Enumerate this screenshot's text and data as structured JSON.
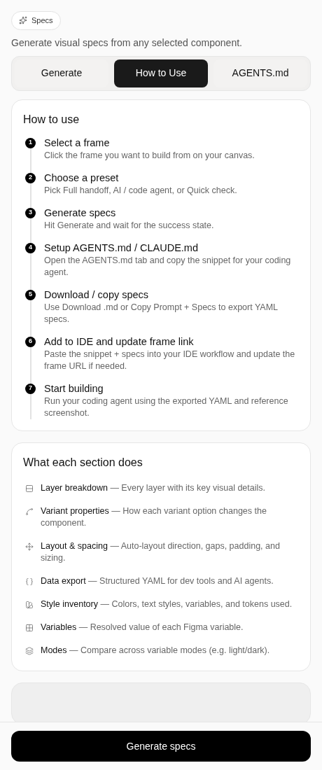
{
  "badge": {
    "label": "Specs"
  },
  "subtitle": "Generate visual specs from any selected component.",
  "tabs": [
    {
      "label": "Generate",
      "selected": false
    },
    {
      "label": "How to Use",
      "selected": true
    },
    {
      "label": "AGENTS.md",
      "selected": false
    }
  ],
  "how_to_use": {
    "title": "How to use",
    "steps": [
      {
        "number": "1",
        "title": "Select a frame",
        "description": "Click the frame you want to build from on your canvas."
      },
      {
        "number": "2",
        "title": "Choose a preset",
        "description": "Pick Full handoff, AI / code agent, or Quick check."
      },
      {
        "number": "3",
        "title": "Generate specs",
        "description": "Hit Generate and wait for the success state."
      },
      {
        "number": "4",
        "title": "Setup AGENTS.md / CLAUDE.md",
        "description": "Open the AGENTS.md tab and copy the snippet for your coding agent."
      },
      {
        "number": "5",
        "title": "Download / copy specs",
        "description": "Use Download .md or Copy Prompt + Specs to export YAML specs."
      },
      {
        "number": "6",
        "title": "Add to IDE and update frame link",
        "description": "Paste the snippet + specs into your IDE workflow and update the frame URL if needed."
      },
      {
        "number": "7",
        "title": "Start building",
        "description": "Run your coding agent using the exported YAML and reference screenshot."
      }
    ]
  },
  "sections": {
    "title": "What each section does",
    "items": [
      {
        "kind": "layers",
        "name": "Layer breakdown",
        "description": "— Every layer with its key visual details."
      },
      {
        "kind": "variants",
        "name": "Variant properties",
        "description": "— How each variant option changes the component."
      },
      {
        "kind": "layout",
        "name": "Layout & spacing",
        "description": "— Auto-layout direction, gaps, padding, and sizing."
      },
      {
        "kind": "data",
        "name": "Data export",
        "description": "— Structured YAML for dev tools and AI agents."
      },
      {
        "kind": "styles",
        "name": "Style inventory",
        "description": "— Colors, text styles, variables, and tokens used."
      },
      {
        "kind": "variables",
        "name": "Variables",
        "description": "— Resolved value of each Figma variable."
      },
      {
        "kind": "modes",
        "name": "Modes",
        "description": "— Compare across variable modes (e.g. light/dark)."
      }
    ]
  },
  "footer": {
    "button": "Generate specs"
  }
}
